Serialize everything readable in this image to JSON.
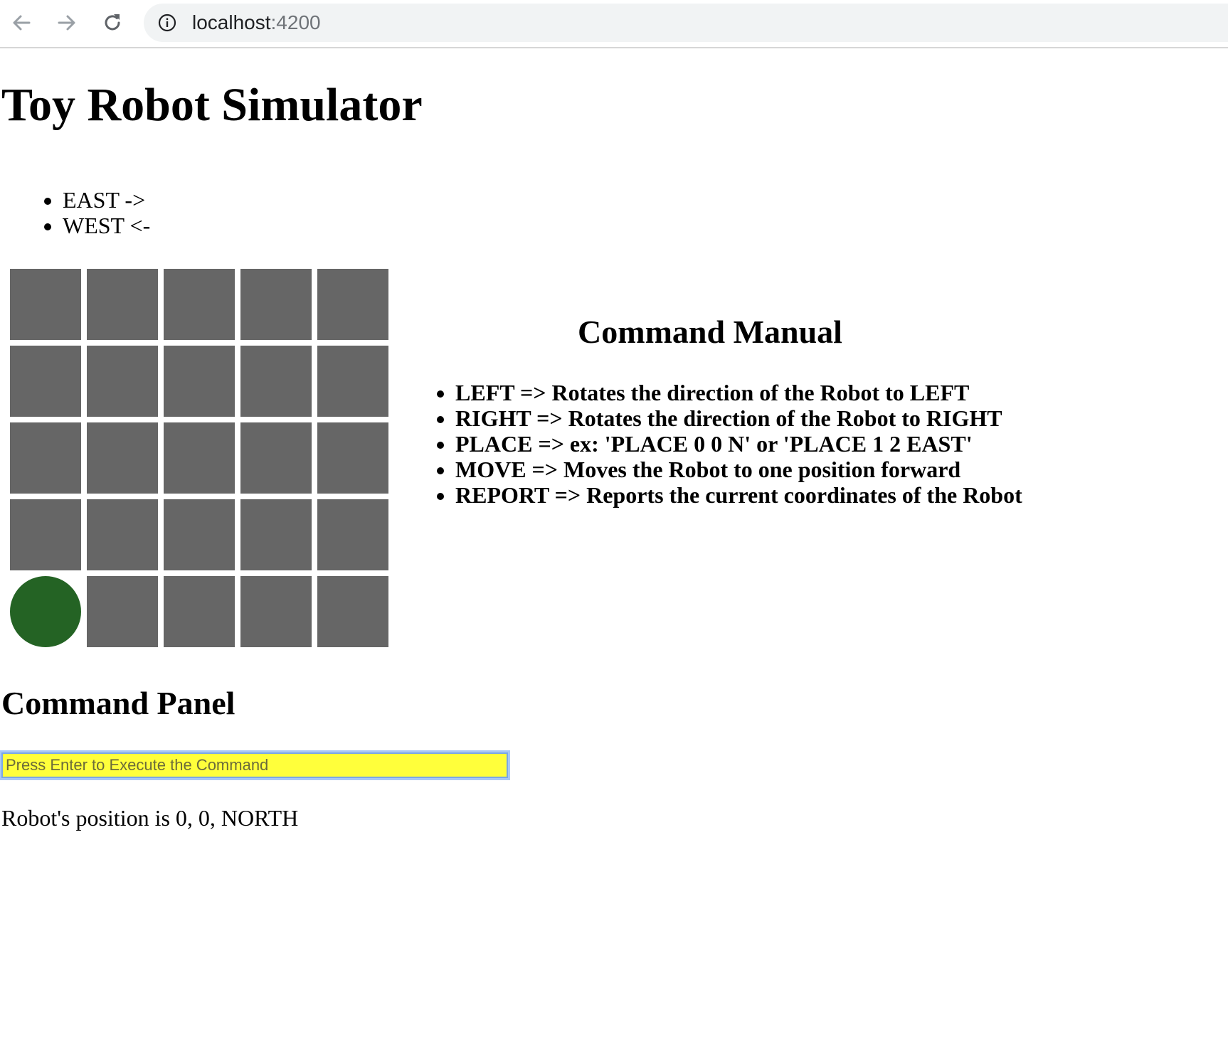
{
  "browser": {
    "url_host": "localhost",
    "url_port": ":4200"
  },
  "page": {
    "title": "Toy Robot Simulator",
    "directions": [
      {
        "label": "EAST ->"
      },
      {
        "label": "WEST <-"
      }
    ],
    "board": {
      "rows": 5,
      "columns": 5,
      "cell_color": "#666666",
      "robot_color": "#246324",
      "robot_x": 0,
      "robot_y": 0
    },
    "manual": {
      "heading": "Command Manual",
      "items": [
        {
          "label": "LEFT => Rotates the direction of the Robot to LEFT"
        },
        {
          "label": "RIGHT => Rotates the direction of the Robot to RIGHT"
        },
        {
          "label": "PLACE => ex: 'PLACE 0 0 N' or 'PLACE 1 2 EAST'"
        },
        {
          "label": "MOVE => Moves the Robot to one position forward"
        },
        {
          "label": "REPORT => Reports the current coordinates of the Robot"
        }
      ]
    },
    "panel": {
      "heading": "Command Panel",
      "input_placeholder": "Press Enter to Execute the Command",
      "input_value": "",
      "input_bg_color": "#ffff3b",
      "status": "Robot's position is 0, 0, NORTH"
    }
  }
}
